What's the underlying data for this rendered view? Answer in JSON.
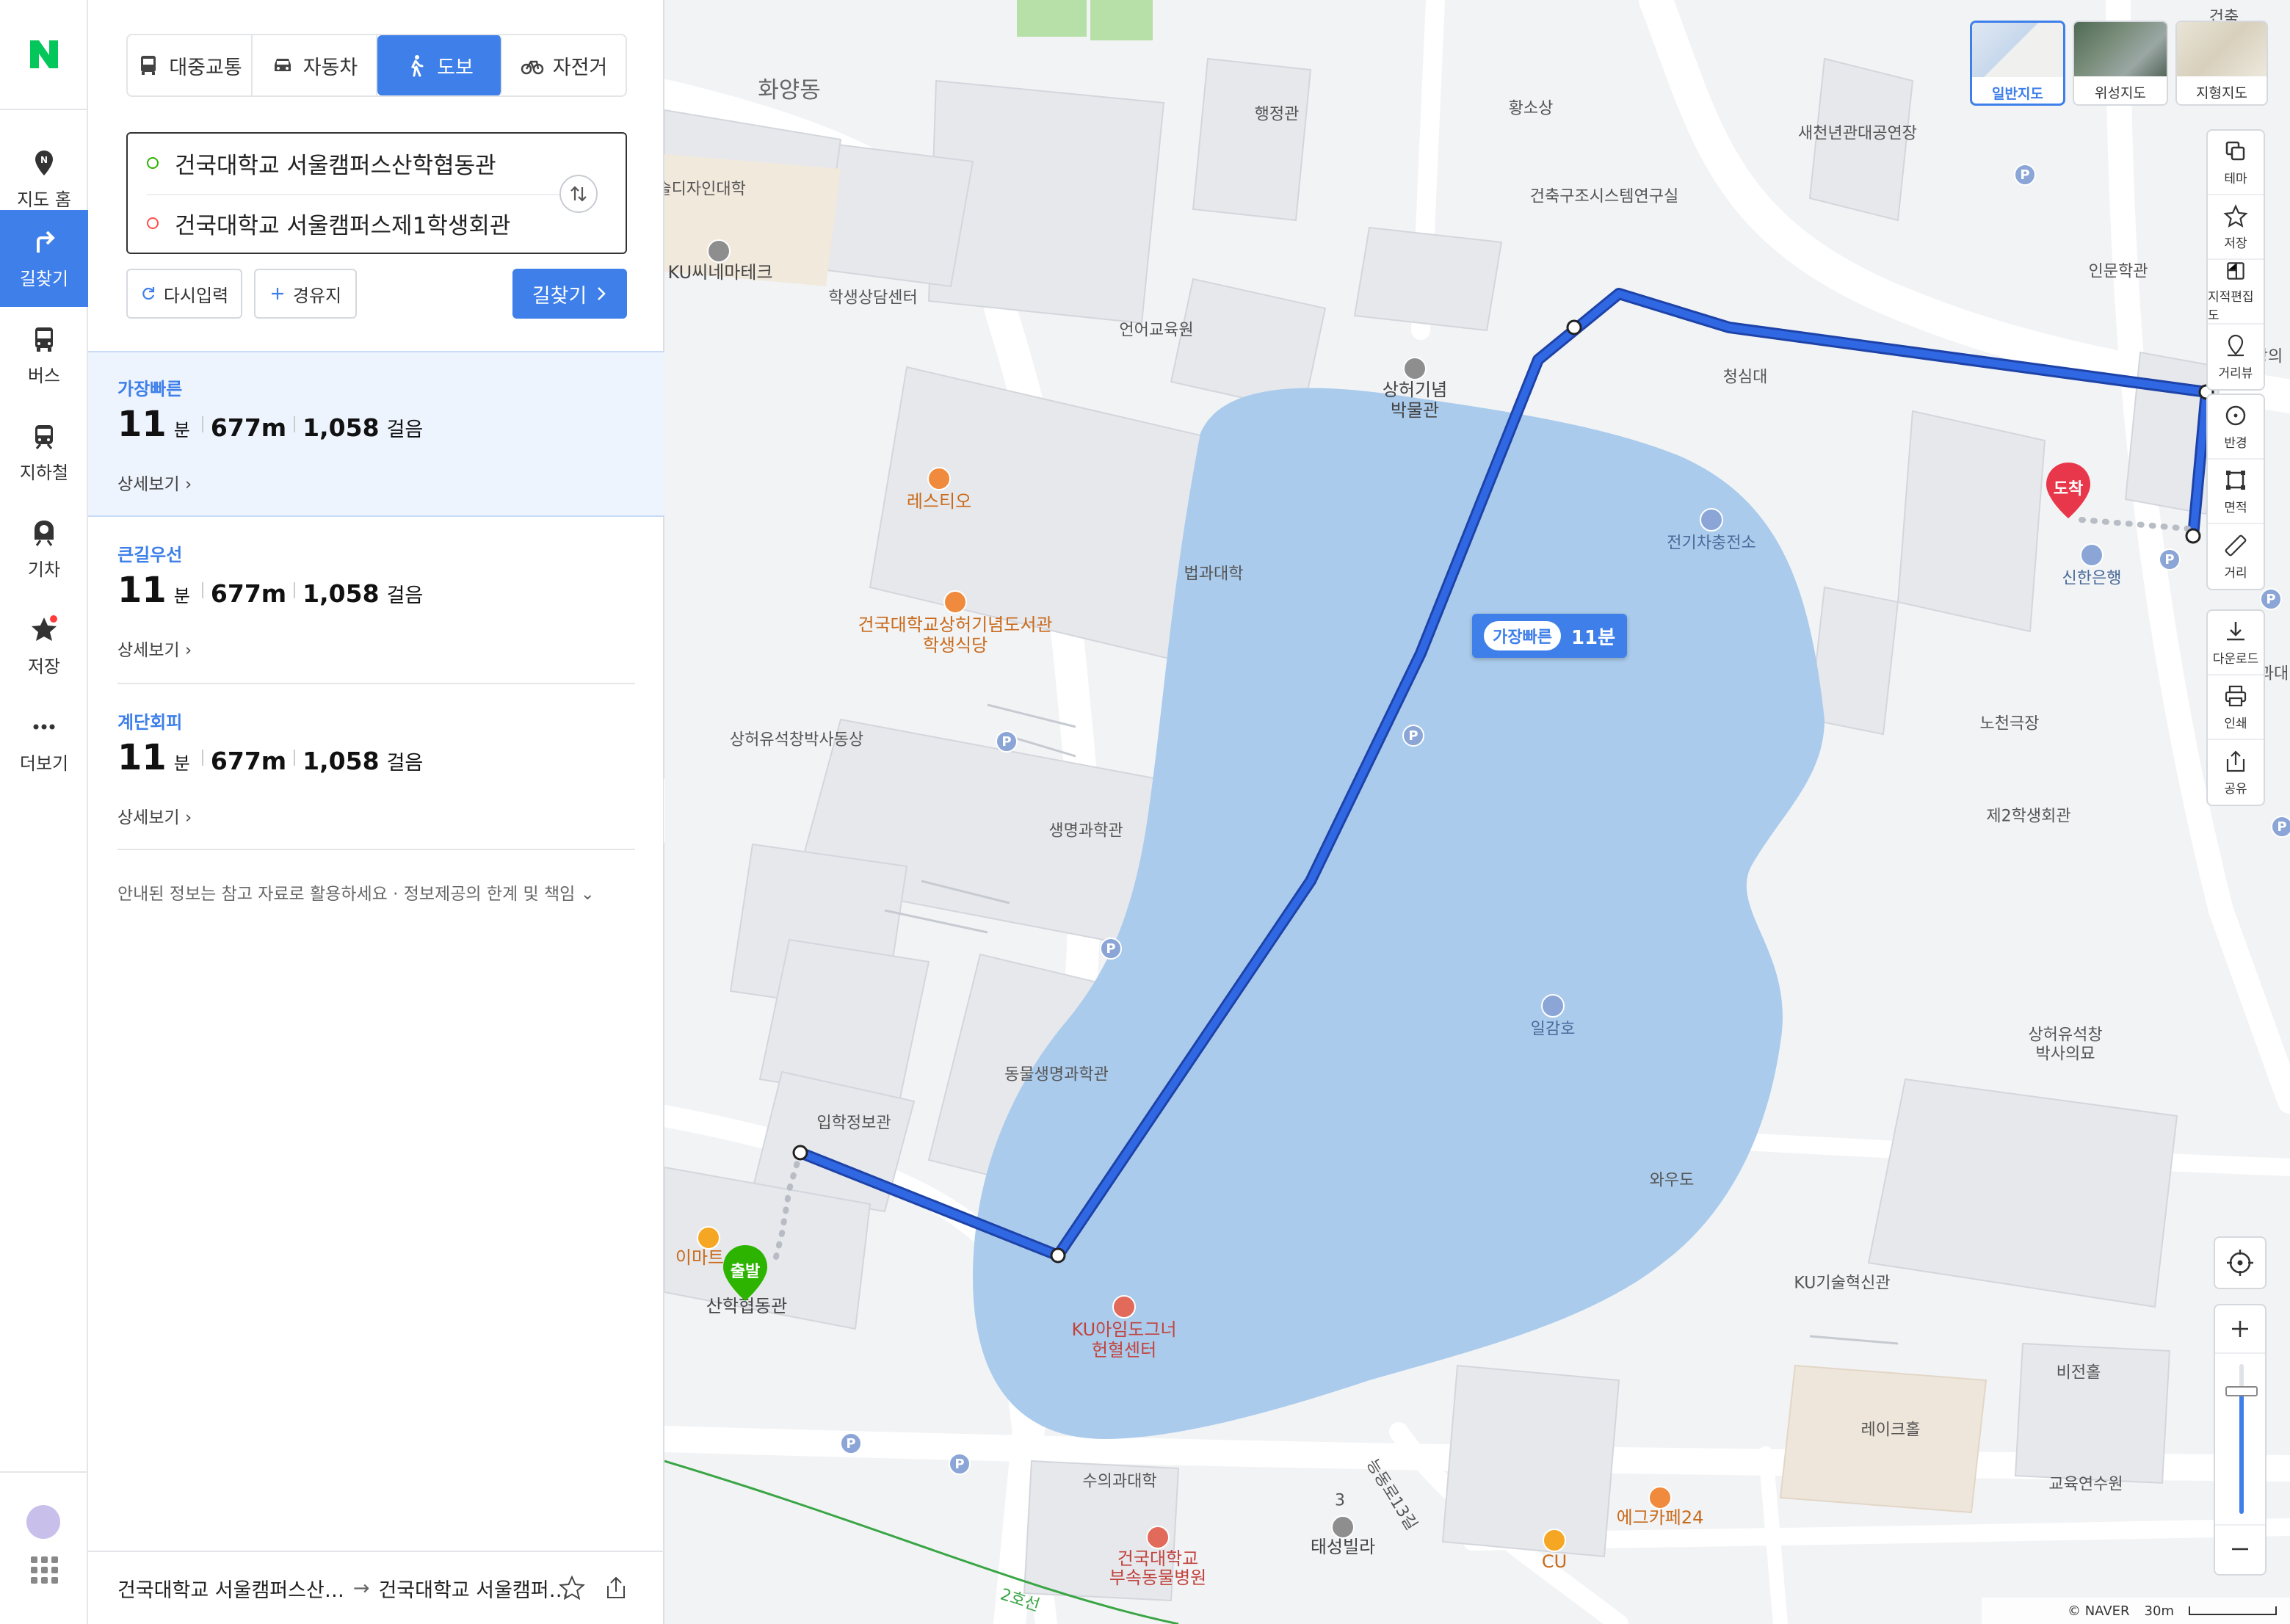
{
  "rail": {
    "items": [
      {
        "label": "지도 홈"
      },
      {
        "label": "길찾기"
      },
      {
        "label": "버스"
      },
      {
        "label": "지하철"
      },
      {
        "label": "기차"
      },
      {
        "label": "저장"
      },
      {
        "label": "더보기"
      }
    ]
  },
  "modes": [
    {
      "label": "대중교통"
    },
    {
      "label": "자동차"
    },
    {
      "label": "도보"
    },
    {
      "label": "자전거"
    }
  ],
  "search": {
    "origin": "건국대학교 서울캠퍼스산학협동관",
    "destination": "건국대학교 서울캠퍼스제1학생회관"
  },
  "actions": {
    "reset": "다시입력",
    "waypoint": "경유지",
    "go": "길찾기"
  },
  "routes": [
    {
      "type": "가장빠른",
      "minutes": "11",
      "min_unit": "분",
      "distance": "677m",
      "steps": "1,058",
      "steps_unit": "걸음",
      "detail": "상세보기"
    },
    {
      "type": "큰길우선",
      "minutes": "11",
      "min_unit": "분",
      "distance": "677m",
      "steps": "1,058",
      "steps_unit": "걸음",
      "detail": "상세보기"
    },
    {
      "type": "계단회피",
      "minutes": "11",
      "min_unit": "분",
      "distance": "677m",
      "steps": "1,058",
      "steps_unit": "걸음",
      "detail": "상세보기"
    }
  ],
  "notice": "안내된 정보는 참고 자료로 활용하세요 · 정보제공의 한계 및 책임",
  "bottom": {
    "from": "건국대학교 서울캠퍼스산…",
    "to": "건국대학교 서울캠퍼…"
  },
  "map": {
    "route_tag": {
      "type": "가장빠른",
      "time": "11분"
    },
    "start_label": "출발",
    "end_label": "도착",
    "labels": [
      "화양동",
      "행정관",
      "황소상",
      "새천년관대공연장",
      "예술디자인대학",
      "건축구조시스템연구실",
      "KU씨네마테크",
      "학생상담센터",
      "언어교육원",
      "상허기념",
      "박물관",
      "청심대",
      "인문학관",
      "레스티오",
      "전기차충전소",
      "신한은행",
      "법과대학",
      "건국대학교상허기념도서관",
      "학생식당",
      "노천극장",
      "상허유석창박사동상",
      "제2학생회관",
      "생명과학관",
      "일감호",
      "동물생명과학관",
      "상허유석창",
      "박사의묘",
      "입학정보관",
      "와우도",
      "이마트",
      "산학협동관",
      "KU아임도그너",
      "헌혈센터",
      "KU기술혁신관",
      "비전홀",
      "레이크홀",
      "교육연수원",
      "수의과대학",
      "에그카페24",
      "태성빌라",
      "CU",
      "건국대학교",
      "부속동물병원",
      "2호선",
      "능동로13길",
      "3",
      "강의",
      "과대",
      "건축"
    ],
    "map_types": [
      "일반지도",
      "위성지도",
      "지형지도"
    ],
    "tools": [
      "테마",
      "저장",
      "지적편집도",
      "거리뷰",
      "반경",
      "면적",
      "거리",
      "다운로드",
      "인쇄",
      "공유"
    ],
    "copyright": "© NAVER",
    "scale": "30m"
  },
  "colors": {
    "accent": "#3e7fe9",
    "route_line": "#2b5fd3",
    "water": "#aacbec",
    "start_pin": "#2db400",
    "end_pin": "#e8374a"
  }
}
